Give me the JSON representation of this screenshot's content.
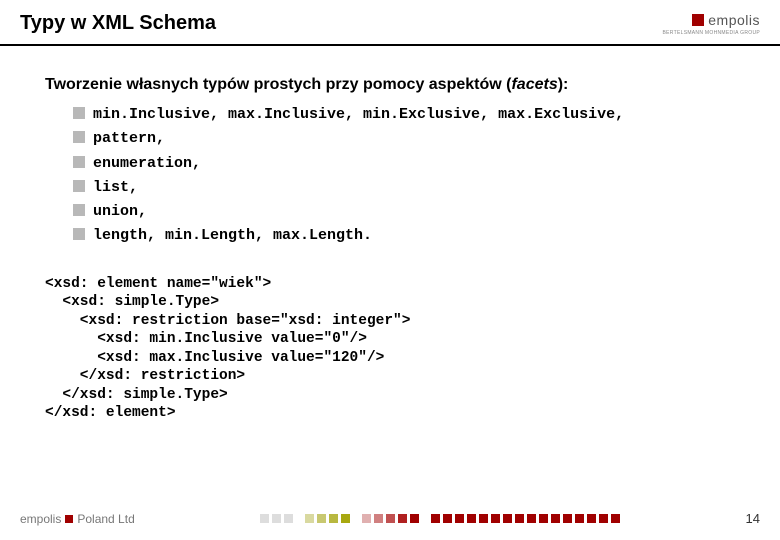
{
  "header": {
    "title": "Typy w XML Schema",
    "logo_text": "empolis",
    "logo_sub": "BERTELSMANN MOHNMEDIA GROUP"
  },
  "content": {
    "subtitle_prefix": "Tworzenie własnych typów prostych przy pomocy aspektów (",
    "subtitle_italic": "facets",
    "subtitle_suffix": "):",
    "bullets": [
      "min.Inclusive, max.Inclusive, min.Exclusive, max.Exclusive,",
      "pattern,",
      "enumeration,",
      "list,",
      "union,",
      "length, min.Length, max.Length."
    ],
    "code": "<xsd: element name=\"wiek\">\n  <xsd: simple.Type>\n    <xsd: restriction base=\"xsd: integer\">\n      <xsd: min.Inclusive value=\"0\"/>\n      <xsd: max.Inclusive value=\"120\"/>\n    </xsd: restriction>\n  </xsd: simple.Type>\n</xsd: element>"
  },
  "footer": {
    "logo_left": "empolis",
    "logo_right": "Poland Ltd",
    "page_number": "14",
    "square_colors": [
      "#dddddd",
      "#dddddd",
      "#dddddd",
      "transparent",
      "#d9d9a0",
      "#c8c870",
      "#b8b840",
      "#a8a810",
      "transparent",
      "#e0b0b0",
      "#d08080",
      "#c05050",
      "#b02020",
      "#a00000",
      "transparent",
      "#a00000",
      "#a00000",
      "#a00000",
      "#a00000",
      "#a00000",
      "#a00000",
      "#a00000",
      "#a00000",
      "#a00000",
      "#a00000",
      "#a00000",
      "#a00000",
      "#a00000",
      "#a00000",
      "#a00000",
      "#a00000"
    ]
  }
}
